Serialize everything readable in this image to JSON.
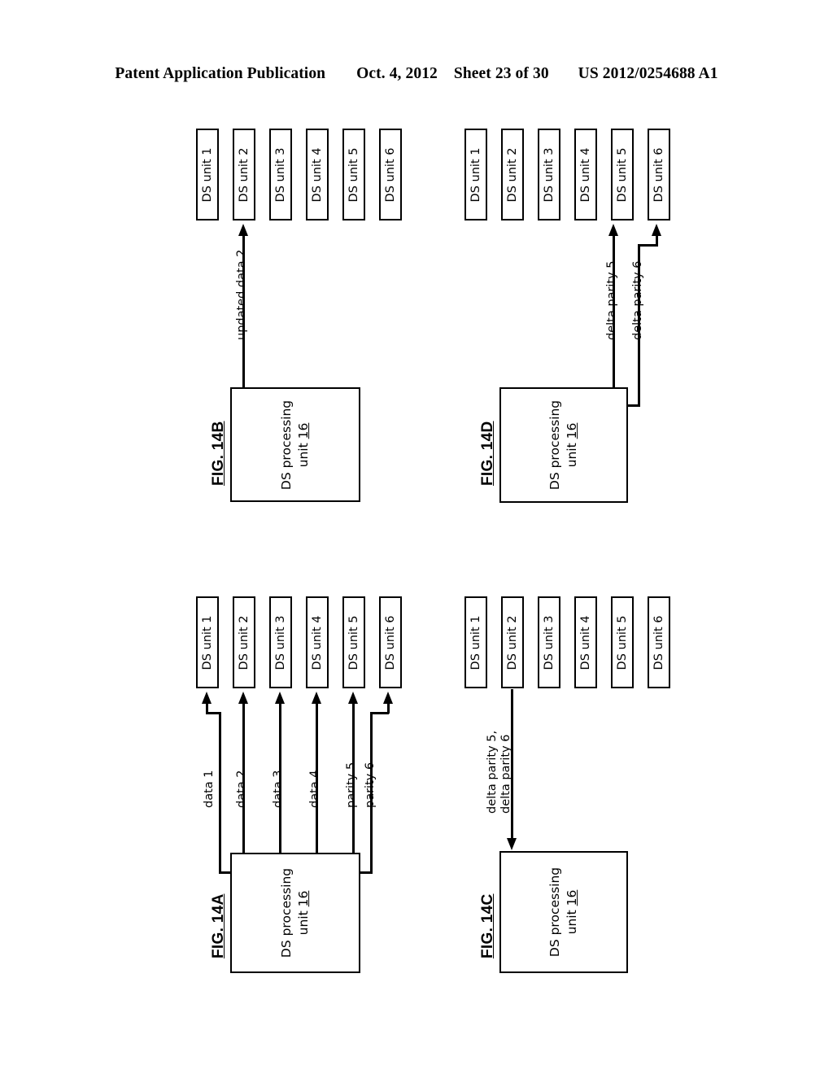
{
  "header": {
    "publication": "Patent Application Publication",
    "date": "Oct. 4, 2012",
    "sheet": "Sheet 23 of 30",
    "number": "US 2012/0254688 A1"
  },
  "common": {
    "proc_line1": "DS processing",
    "proc_line2_prefix": "unit ",
    "proc_line2_ref": "16",
    "ds_units": [
      "DS unit 1",
      "DS unit 2",
      "DS unit 3",
      "DS unit 4",
      "DS unit 5",
      "DS unit 6"
    ]
  },
  "figures": [
    {
      "id": "fig-14a",
      "caption": "FIG. 14A",
      "proc_unit": {
        "line1": "DS processing",
        "line2_prefix": "unit ",
        "line2_ref": "16"
      },
      "ds_units": [
        "DS unit 1",
        "DS unit 2",
        "DS unit 3",
        "DS unit 4",
        "DS unit 5",
        "DS unit 6"
      ],
      "edges": [
        {
          "label": "data 1",
          "from": "DS processing unit 16",
          "to": "DS unit 1",
          "direction": "to-ds-unit"
        },
        {
          "label": "data 2",
          "from": "DS processing unit 16",
          "to": "DS unit 2",
          "direction": "to-ds-unit"
        },
        {
          "label": "data 3",
          "from": "DS processing unit 16",
          "to": "DS unit 3",
          "direction": "to-ds-unit"
        },
        {
          "label": "data 4",
          "from": "DS processing unit 16",
          "to": "DS unit 4",
          "direction": "to-ds-unit"
        },
        {
          "label": "parity 5",
          "from": "DS processing unit 16",
          "to": "DS unit 5",
          "direction": "to-ds-unit"
        },
        {
          "label": "parity 6",
          "from": "DS processing unit 16",
          "to": "DS unit 6",
          "direction": "to-ds-unit"
        }
      ]
    },
    {
      "id": "fig-14b",
      "caption": "FIG. 14B",
      "proc_unit": {
        "line1": "DS processing",
        "line2_prefix": "unit ",
        "line2_ref": "16"
      },
      "ds_units": [
        "DS unit 1",
        "DS unit 2",
        "DS unit 3",
        "DS unit 4",
        "DS unit 5",
        "DS unit 6"
      ],
      "edges": [
        {
          "label": "updated data 2",
          "from": "DS processing unit 16",
          "to": "DS unit 2",
          "direction": "to-ds-unit"
        }
      ]
    },
    {
      "id": "fig-14c",
      "caption": "FIG. 14C",
      "proc_unit": {
        "line1": "DS processing",
        "line2_prefix": "unit ",
        "line2_ref": "16"
      },
      "ds_units": [
        "DS unit 1",
        "DS unit 2",
        "DS unit 3",
        "DS unit 4",
        "DS unit 5",
        "DS unit 6"
      ],
      "edges": [
        {
          "label_line1": "delta parity 5,",
          "label_line2": "delta parity 6",
          "from": "DS unit 2",
          "to": "DS processing unit 16",
          "direction": "to-proc-unit"
        }
      ]
    },
    {
      "id": "fig-14d",
      "caption": "FIG. 14D",
      "proc_unit": {
        "line1": "DS processing",
        "line2_prefix": "unit ",
        "line2_ref": "16"
      },
      "ds_units": [
        "DS unit 1",
        "DS unit 2",
        "DS unit 3",
        "DS unit 4",
        "DS unit 5",
        "DS unit 6"
      ],
      "edges": [
        {
          "label": "delta parity 5",
          "from": "DS processing unit 16",
          "to": "DS unit 5",
          "direction": "to-ds-unit"
        },
        {
          "label": "delta parity 6",
          "from": "DS processing unit 16",
          "to": "DS unit 6",
          "direction": "to-ds-unit"
        }
      ]
    }
  ]
}
